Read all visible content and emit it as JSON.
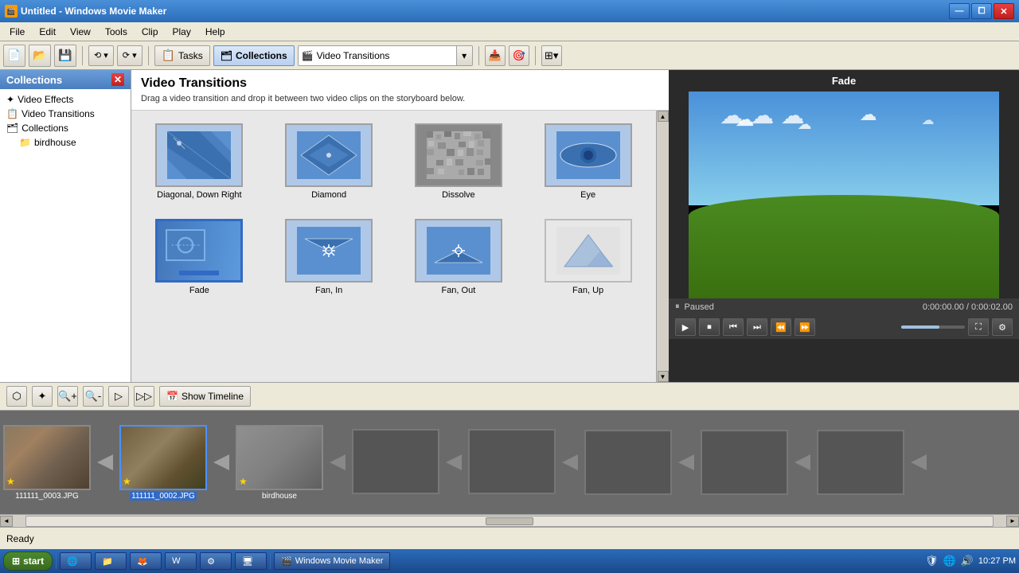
{
  "window": {
    "title": "Untitled - Windows Movie Maker",
    "icon": "🎬"
  },
  "title_bar": {
    "minimize": "—",
    "maximize": "⧠",
    "close": "✕"
  },
  "menu": {
    "items": [
      "File",
      "Edit",
      "View",
      "Tools",
      "Clip",
      "Play",
      "Help"
    ]
  },
  "toolbar": {
    "tasks_label": "Tasks",
    "collections_label": "Collections",
    "dropdown_label": "Video Transitions",
    "undo_label": "⟲",
    "redo_label": "⟳"
  },
  "left_panel": {
    "title": "Collections",
    "close": "✕",
    "items": [
      {
        "label": "Video Effects",
        "icon": "✦"
      },
      {
        "label": "Video Transitions",
        "icon": "📋"
      },
      {
        "label": "Collections",
        "icon": "🗂"
      },
      {
        "label": "birdhouse",
        "icon": "📁",
        "sub": true
      }
    ]
  },
  "transitions": {
    "title": "Video Transitions",
    "description": "Drag a video transition and drop it between two video clips on the storyboard below.",
    "items": [
      {
        "id": "diagonal-down-right",
        "label": "Diagonal, Down Right"
      },
      {
        "id": "diamond",
        "label": "Diamond"
      },
      {
        "id": "dissolve",
        "label": "Dissolve"
      },
      {
        "id": "eye",
        "label": "Eye"
      },
      {
        "id": "fade",
        "label": "Fade",
        "selected": true
      },
      {
        "id": "fan-in",
        "label": "Fan, In"
      },
      {
        "id": "fan-out",
        "label": "Fan, Out"
      },
      {
        "id": "fan-up",
        "label": "Fan, Up"
      }
    ]
  },
  "preview": {
    "title": "Fade",
    "status": "Paused",
    "time": "0:00:00.00 / 0:00:02.00",
    "buttons": [
      "⏮",
      "⏹",
      "⏸",
      "⏭",
      "⏩",
      "⏪"
    ]
  },
  "storyboard": {
    "show_timeline_label": "Show Timeline",
    "clips": [
      {
        "label": "111111_0003.JPG",
        "selected": false
      },
      {
        "label": "111111_0002.JPG",
        "selected": true
      },
      {
        "label": "birdhouse",
        "selected": false
      }
    ]
  },
  "status": {
    "text": "Ready"
  },
  "taskbar": {
    "start": "start",
    "apps": [
      "Windows Movie Maker"
    ],
    "time": "10:27 PM",
    "tray_icons": [
      "🔊",
      "🌐",
      "🛡"
    ]
  }
}
